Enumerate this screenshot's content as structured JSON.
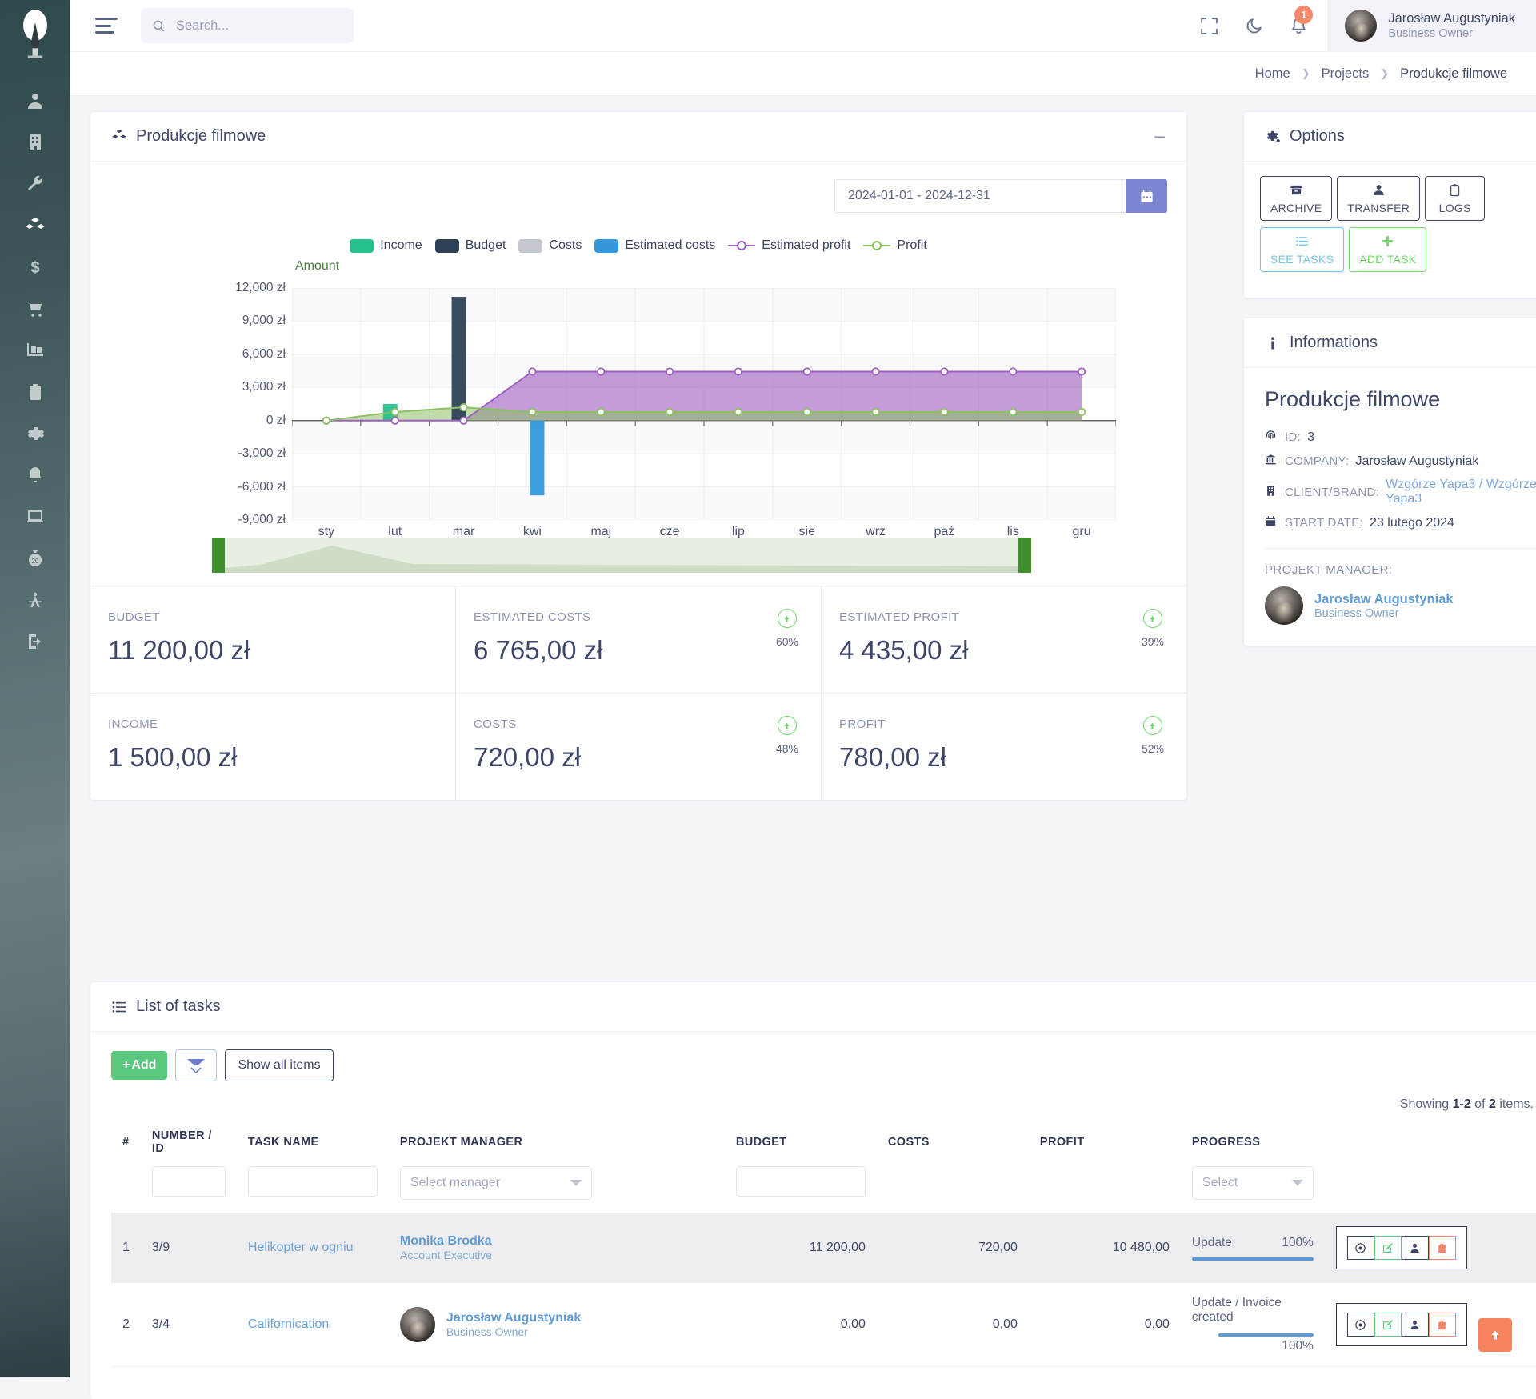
{
  "header": {
    "search_placeholder": "Search...",
    "search_value": "",
    "notification_count": "1",
    "user_name": "Jarosław Augustyniak",
    "user_role": "Business Owner"
  },
  "breadcrumb": {
    "home": "Home",
    "projects": "Projects",
    "current": "Produkcje filmowe"
  },
  "sidebar": {
    "items": [
      {
        "icon": "user-icon"
      },
      {
        "icon": "building-icon"
      },
      {
        "icon": "wrench-icon"
      },
      {
        "icon": "cubes-icon"
      },
      {
        "icon": "dollar-icon"
      },
      {
        "icon": "shopping-cart-icon"
      },
      {
        "icon": "luggage-cart-icon"
      },
      {
        "icon": "clipboard-icon"
      },
      {
        "icon": "gear-icon"
      },
      {
        "icon": "bell-icon"
      },
      {
        "icon": "laptop-icon"
      },
      {
        "icon": "money-bag-icon"
      },
      {
        "icon": "drafting-compass-icon"
      },
      {
        "icon": "logout-icon"
      }
    ]
  },
  "chart_card": {
    "title": "Produkcje filmowe",
    "date_range": "2024-01-01 - 2024-12-31",
    "collapse": "−"
  },
  "chart_data": {
    "type": "area",
    "title": "",
    "ylabel": "Amount",
    "xlabel": "",
    "ylim": [
      -9000,
      12000
    ],
    "yticks": [
      "12,000 zł",
      "9,000 zł",
      "6,000 zł",
      "3,000 zł",
      "0 zł",
      "-3,000 zł",
      "-6,000 zł",
      "-9,000 zł"
    ],
    "ytick_values": [
      12000,
      9000,
      6000,
      3000,
      0,
      -3000,
      -6000,
      -9000
    ],
    "categories": [
      "sty",
      "lut",
      "mar",
      "kwi",
      "maj",
      "cze",
      "lip",
      "sie",
      "wrz",
      "paź",
      "lis",
      "gru"
    ],
    "grid": true,
    "legend_position": "top",
    "series": [
      {
        "name": "Income",
        "type": "bar",
        "color": "#26c18c",
        "values": [
          0,
          1500,
          0,
          0,
          0,
          0,
          0,
          0,
          0,
          0,
          0,
          0
        ]
      },
      {
        "name": "Budget",
        "type": "bar",
        "color": "#2d4257",
        "values": [
          0,
          0,
          11200,
          0,
          0,
          0,
          0,
          0,
          0,
          0,
          0,
          0
        ]
      },
      {
        "name": "Costs",
        "type": "bar",
        "color": "#c4c7ce",
        "values": [
          0,
          0,
          0,
          -720,
          0,
          0,
          0,
          0,
          0,
          0,
          0,
          0
        ]
      },
      {
        "name": "Estimated costs",
        "type": "bar",
        "color": "#3498db",
        "values": [
          0,
          0,
          0,
          -6765,
          0,
          0,
          0,
          0,
          0,
          0,
          0,
          0
        ]
      },
      {
        "name": "Estimated profit",
        "type": "line",
        "color": "#a05fc0",
        "values": [
          0,
          0,
          0,
          4435,
          4435,
          4435,
          4435,
          4435,
          4435,
          4435,
          4435,
          4435
        ]
      },
      {
        "name": "Profit",
        "type": "line",
        "color": "#8cc063",
        "values": [
          0,
          780,
          1200,
          780,
          780,
          780,
          780,
          780,
          780,
          780,
          780,
          780
        ]
      }
    ]
  },
  "kpis": [
    {
      "label": "BUDGET",
      "value": "11 200,00 zł",
      "pct": "",
      "show_pct": false
    },
    {
      "label": "ESTIMATED COSTS",
      "value": "6 765,00 zł",
      "pct": "60%",
      "show_pct": true
    },
    {
      "label": "ESTIMATED PROFIT",
      "value": "4 435,00 zł",
      "pct": "39%",
      "show_pct": true
    },
    {
      "label": "INCOME",
      "value": "1 500,00 zł",
      "pct": "",
      "show_pct": false
    },
    {
      "label": "COSTS",
      "value": "720,00 zł",
      "pct": "48%",
      "show_pct": true
    },
    {
      "label": "PROFIT",
      "value": "780,00 zł",
      "pct": "52%",
      "show_pct": true
    }
  ],
  "options_card": {
    "title": "Options",
    "collapse": "−",
    "buttons": [
      {
        "label": "ARCHIVE",
        "icon": "archive-icon",
        "style": "dark"
      },
      {
        "label": "TRANSFER",
        "icon": "user-icon",
        "style": "dark"
      },
      {
        "label": "LOGS",
        "icon": "clipboard-icon",
        "style": "dark"
      },
      {
        "label": "SEE TASKS",
        "icon": "list-icon",
        "style": "blue"
      },
      {
        "label": "ADD TASK",
        "icon": "plus-icon",
        "style": "green"
      }
    ]
  },
  "info_card": {
    "title": "Informations",
    "collapse": "−",
    "project_name": "Produkcje filmowe",
    "rows": [
      {
        "icon": "fingerprint-icon",
        "key": "ID:",
        "value": "3",
        "link": false
      },
      {
        "icon": "bank-icon",
        "key": "COMPANY:",
        "value": "Jarosław Augustyniak",
        "link": false
      },
      {
        "icon": "building-icon",
        "key": "CLIENT/BRAND:",
        "value": "Wzgórze Yapa3 / Wzgórze Yapa3",
        "link": true
      },
      {
        "icon": "calendar-icon",
        "key": "START DATE:",
        "value": "23 lutego 2024",
        "link": false
      }
    ],
    "pm_label": "PROJEKT MANAGER:",
    "pm_name": "Jarosław Augustyniak",
    "pm_role": "Business Owner"
  },
  "tasks_card": {
    "title": "List of tasks",
    "collapse": "−",
    "add_label": "Add",
    "show_all_label": "Show all items",
    "showing_prefix": "Showing ",
    "showing_range": "1-2",
    "showing_mid": " of ",
    "showing_total": "2",
    "showing_suffix": " items.",
    "columns": [
      "#",
      "NUMBER / ID",
      "TASK NAME",
      "PROJEKT MANAGER",
      "BUDGET",
      "COSTS",
      "PROFIT",
      "PROGRESS",
      ""
    ],
    "filters": {
      "manager_placeholder": "Select manager",
      "progress_placeholder": "Select"
    },
    "rows": [
      {
        "index": "1",
        "number_id": "3/9",
        "task_name": "Helikopter w ogniu",
        "manager_name": "Monika Brodka",
        "manager_role": "Account Executive",
        "has_avatar": false,
        "budget": "11 200,00",
        "costs": "720,00",
        "profit": "10 480,00",
        "progress_label": "Update",
        "progress_pct": "100%",
        "progress_value": 100,
        "stacked": false
      },
      {
        "index": "2",
        "number_id": "3/4",
        "task_name": "Californication",
        "manager_name": "Jarosław Augustyniak",
        "manager_role": "Business Owner",
        "has_avatar": true,
        "budget": "0,00",
        "costs": "0,00",
        "profit": "0,00",
        "progress_label": "Update / Invoice created",
        "progress_pct": "100%",
        "progress_value": 100,
        "stacked": true
      }
    ]
  },
  "colors": {
    "accent_blue": "#7b85d1",
    "green": "#5bc97d",
    "orange": "#f5845f",
    "dark": "#3d4465"
  }
}
